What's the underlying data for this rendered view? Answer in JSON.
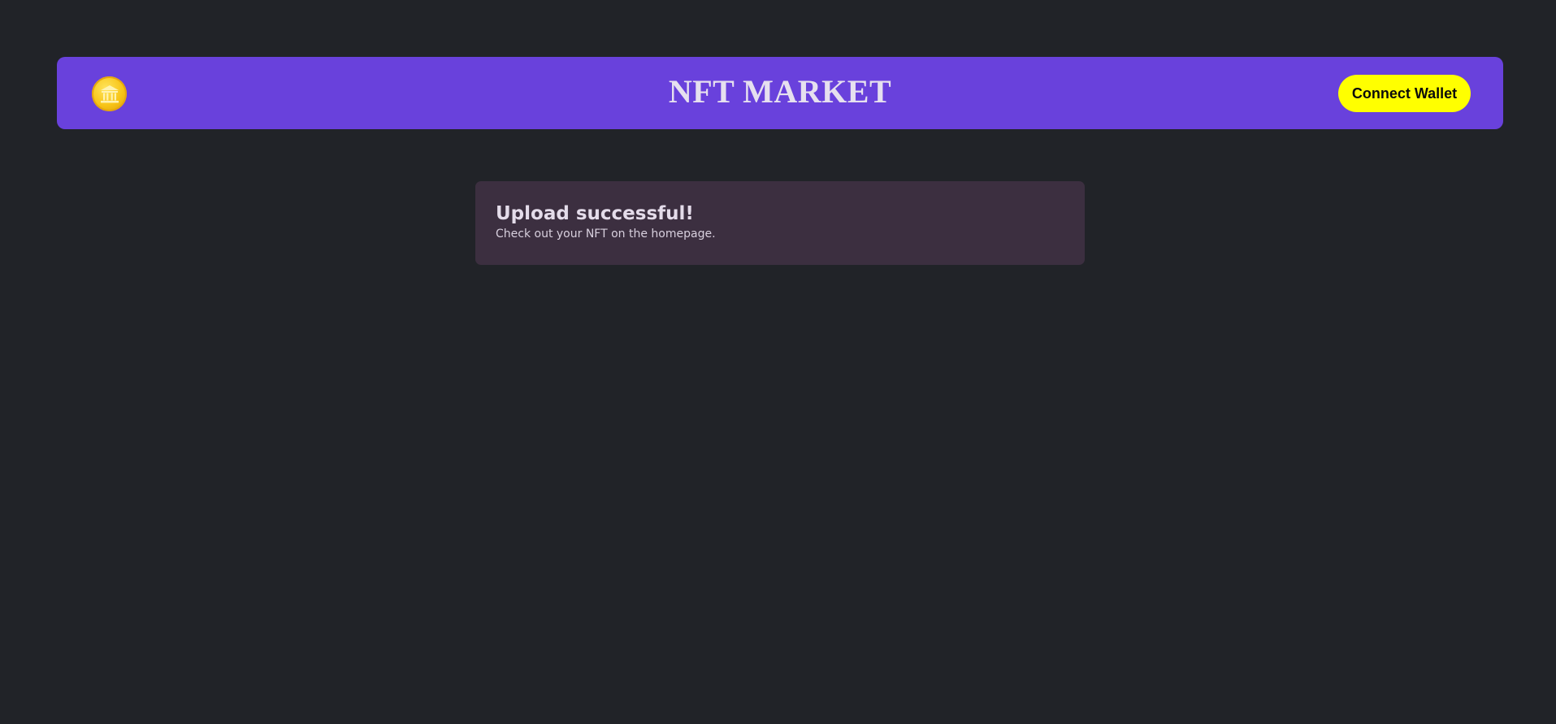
{
  "navbar": {
    "logo_icon": "coin-bank-icon",
    "title": "NFT MARKET",
    "connect_label": "Connect Wallet"
  },
  "alert": {
    "title": "Upload successful!",
    "message": "Check out your NFT on the homepage."
  },
  "colors": {
    "background": "#212328",
    "navbar": "#6941dc",
    "button": "#ffff00",
    "alert": "#3c2f40",
    "logo": "#f7c416"
  }
}
